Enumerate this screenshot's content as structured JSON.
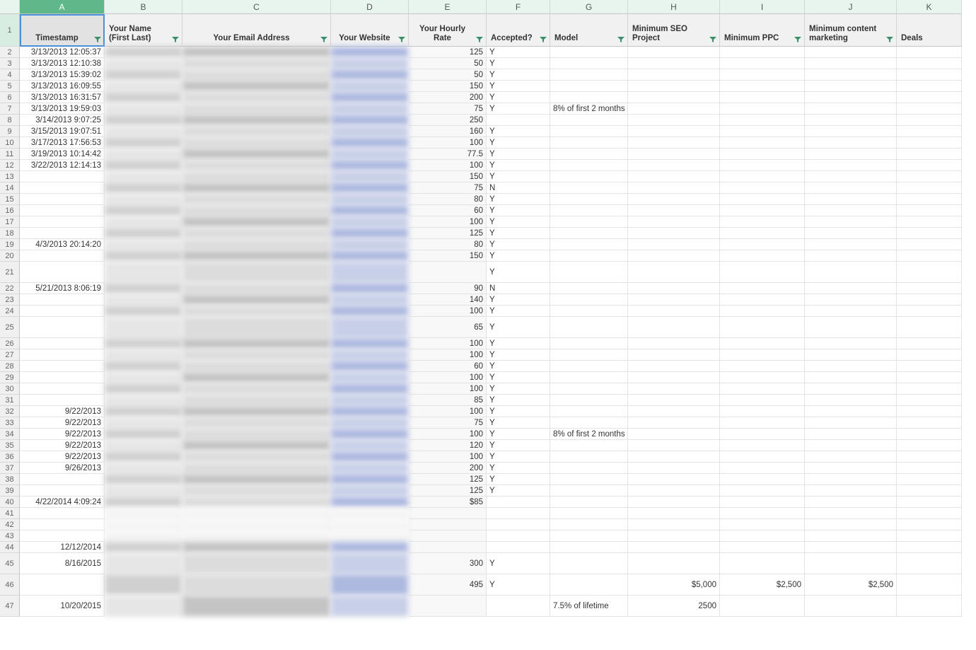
{
  "cols": [
    "A",
    "B",
    "C",
    "D",
    "E",
    "F",
    "G",
    "H",
    "I",
    "J",
    "K"
  ],
  "headers": {
    "A": "Timestamp",
    "B": "Your Name (First Last)",
    "C": "Your Email Address",
    "D": "Your Website",
    "E": "Your Hourly Rate",
    "F": "Accepted?",
    "G": "Model",
    "H": "Minimum SEO Project",
    "I": "Minimum PPC",
    "J": "Minimum content marketing",
    "K": "Deals"
  },
  "rows": [
    {
      "n": 2,
      "ts": "3/13/2013 12:05:37",
      "rate": "125",
      "acc": "Y"
    },
    {
      "n": 3,
      "ts": "3/13/2013 12:10:38",
      "rate": "50",
      "acc": "Y"
    },
    {
      "n": 4,
      "ts": "3/13/2013 15:39:02",
      "rate": "50",
      "acc": "Y"
    },
    {
      "n": 5,
      "ts": "3/13/2013 16:09:55",
      "rate": "150",
      "acc": "Y"
    },
    {
      "n": 6,
      "ts": "3/13/2013 16:31:57",
      "rate": "200",
      "acc": "Y"
    },
    {
      "n": 7,
      "ts": "3/13/2013 19:59:03",
      "rate": "75",
      "acc": "Y",
      "model": "8% of first 2 months"
    },
    {
      "n": 8,
      "ts": "3/14/2013 9:07:25",
      "rate": "250",
      "acc": ""
    },
    {
      "n": 9,
      "ts": "3/15/2013 19:07:51",
      "rate": "160",
      "acc": "Y"
    },
    {
      "n": 10,
      "ts": "3/17/2013 17:56:53",
      "rate": "100",
      "acc": "Y"
    },
    {
      "n": 11,
      "ts": "3/19/2013 10:14:42",
      "rate": "77.5",
      "acc": "Y"
    },
    {
      "n": 12,
      "ts": "3/22/2013 12:14:13",
      "rate": "100",
      "acc": "Y"
    },
    {
      "n": 13,
      "ts": "",
      "rate": "150",
      "acc": "Y"
    },
    {
      "n": 14,
      "ts": "",
      "rate": "75",
      "acc": "N"
    },
    {
      "n": 15,
      "ts": "",
      "rate": "80",
      "acc": "Y"
    },
    {
      "n": 16,
      "ts": "",
      "rate": "60",
      "acc": "Y"
    },
    {
      "n": 17,
      "ts": "",
      "rate": "100",
      "acc": "Y"
    },
    {
      "n": 18,
      "ts": "",
      "rate": "125",
      "acc": "Y"
    },
    {
      "n": 19,
      "ts": "4/3/2013 20:14:20",
      "rate": "80",
      "acc": "Y"
    },
    {
      "n": 20,
      "ts": "",
      "rate": "150",
      "acc": "Y"
    },
    {
      "n": 21,
      "ts": "",
      "rate": "",
      "acc": "Y",
      "tall": true
    },
    {
      "n": 22,
      "ts": "5/21/2013 8:06:19",
      "rate": "90",
      "acc": "N"
    },
    {
      "n": 23,
      "ts": "",
      "rate": "140",
      "acc": "Y"
    },
    {
      "n": 24,
      "ts": "",
      "rate": "100",
      "acc": "Y"
    },
    {
      "n": 25,
      "ts": "",
      "rate": "65",
      "acc": "Y",
      "tall": true
    },
    {
      "n": 26,
      "ts": "",
      "rate": "100",
      "acc": "Y"
    },
    {
      "n": 27,
      "ts": "",
      "rate": "100",
      "acc": "Y"
    },
    {
      "n": 28,
      "ts": "",
      "rate": "60",
      "acc": "Y"
    },
    {
      "n": 29,
      "ts": "",
      "rate": "100",
      "acc": "Y"
    },
    {
      "n": 30,
      "ts": "",
      "rate": "100",
      "acc": "Y"
    },
    {
      "n": 31,
      "ts": "",
      "rate": "85",
      "acc": "Y"
    },
    {
      "n": 32,
      "ts": "9/22/2013",
      "rate": "100",
      "acc": "Y"
    },
    {
      "n": 33,
      "ts": "9/22/2013",
      "rate": "75",
      "acc": "Y"
    },
    {
      "n": 34,
      "ts": "9/22/2013",
      "rate": "100",
      "acc": "Y",
      "model": "8% of first 2 months"
    },
    {
      "n": 35,
      "ts": "9/22/2013",
      "rate": "120",
      "acc": "Y"
    },
    {
      "n": 36,
      "ts": "9/22/2013",
      "rate": "100",
      "acc": "Y"
    },
    {
      "n": 37,
      "ts": "9/26/2013",
      "rate": "200",
      "acc": "Y"
    },
    {
      "n": 38,
      "ts": "",
      "rate": "125",
      "acc": "Y"
    },
    {
      "n": 39,
      "ts": "",
      "rate": "125",
      "acc": "Y"
    },
    {
      "n": 40,
      "ts": "4/22/2014 4:09:24",
      "rate": "$85",
      "acc": ""
    },
    {
      "n": 41,
      "ts": "",
      "rate": "",
      "acc": "",
      "blank": true
    },
    {
      "n": 42,
      "ts": "",
      "rate": "",
      "acc": "",
      "blank": true
    },
    {
      "n": 43,
      "ts": "",
      "rate": "",
      "acc": "",
      "blank": true
    },
    {
      "n": 44,
      "ts": "12/12/2014",
      "rate": "",
      "acc": ""
    },
    {
      "n": 45,
      "ts": "8/16/2015",
      "rate": "300",
      "acc": "Y",
      "tall": true
    },
    {
      "n": 46,
      "ts": "",
      "rate": "495",
      "acc": "Y",
      "seo": "$5,000",
      "ppc": "$2,500",
      "cm": "$2,500",
      "tall": true
    },
    {
      "n": 47,
      "ts": "10/20/2015",
      "rate": "",
      "acc": "",
      "model": "7.5% of lifetime",
      "seo": "2500",
      "tall": true
    }
  ]
}
